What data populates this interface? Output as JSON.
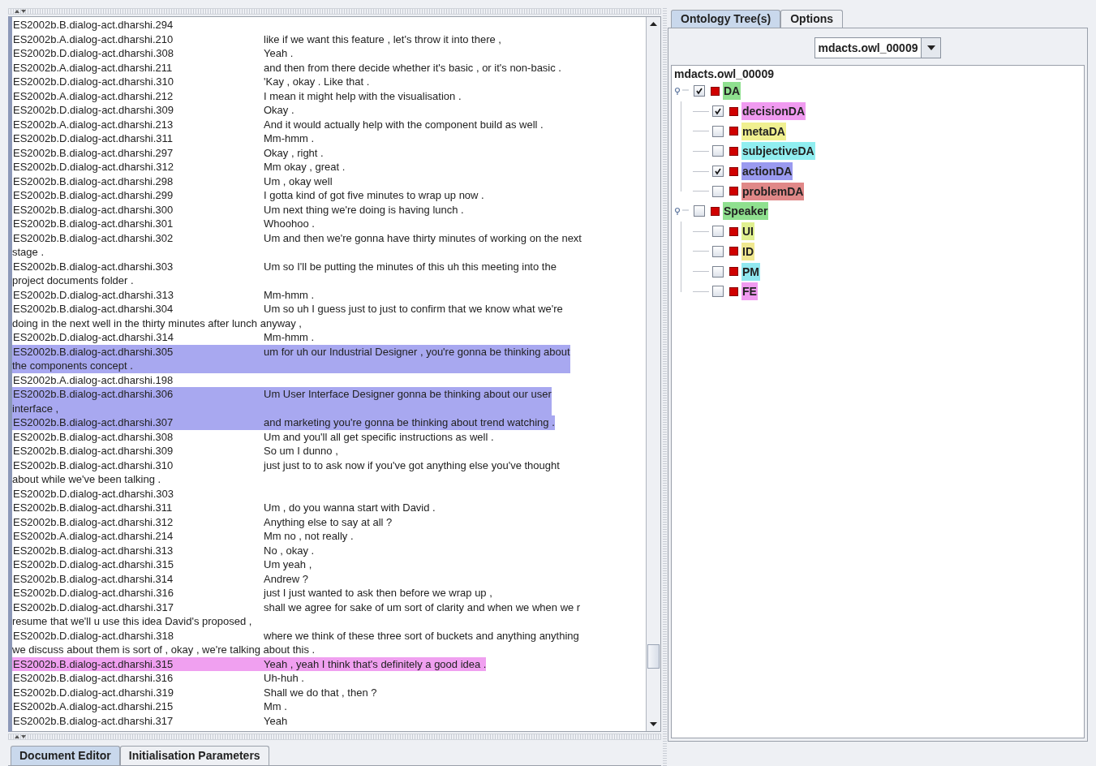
{
  "transcript": {
    "rows": [
      {
        "id": "ES2002b.B.dialog-act.dharshi.294",
        "text": ""
      },
      {
        "id": "ES2002b.A.dialog-act.dharshi.210",
        "text": "like if we want this feature , let's throw it into there ,"
      },
      {
        "id": "ES2002b.D.dialog-act.dharshi.308",
        "text": "Yeah ."
      },
      {
        "id": "ES2002b.A.dialog-act.dharshi.211",
        "text": "and then from there decide whether it's basic , or it's non-basic ."
      },
      {
        "id": "ES2002b.D.dialog-act.dharshi.310",
        "text": "'Kay , okay . Like that ."
      },
      {
        "id": "ES2002b.A.dialog-act.dharshi.212",
        "text": "I mean it might help with the visualisation ."
      },
      {
        "id": "ES2002b.D.dialog-act.dharshi.309",
        "text": "Okay ."
      },
      {
        "id": "ES2002b.A.dialog-act.dharshi.213",
        "text": "And it would actually help with the component build as well ."
      },
      {
        "id": "ES2002b.D.dialog-act.dharshi.311",
        "text": "Mm-hmm ."
      },
      {
        "id": "ES2002b.B.dialog-act.dharshi.297",
        "text": "Okay , right ."
      },
      {
        "id": "ES2002b.D.dialog-act.dharshi.312",
        "text": "Mm okay , great ."
      },
      {
        "id": "ES2002b.B.dialog-act.dharshi.298",
        "text": "Um , okay well"
      },
      {
        "id": "ES2002b.B.dialog-act.dharshi.299",
        "text": "I gotta kind of got five minutes to wrap up now ."
      },
      {
        "id": "ES2002b.B.dialog-act.dharshi.300",
        "text": "Um next thing we're doing is having lunch ."
      },
      {
        "id": "ES2002b.B.dialog-act.dharshi.301",
        "text": "Whoohoo ."
      },
      {
        "id": "ES2002b.B.dialog-act.dharshi.302",
        "text": "Um and then we're gonna have thirty minutes of working on the next",
        "continuation": "stage ."
      },
      {
        "id": "ES2002b.B.dialog-act.dharshi.303",
        "text": "Um so I'll be putting the minutes of this uh this meeting into the",
        "continuation": "project documents folder ."
      },
      {
        "id": "ES2002b.D.dialog-act.dharshi.313",
        "text": "Mm-hmm ."
      },
      {
        "id": "ES2002b.B.dialog-act.dharshi.304",
        "text": "Um so uh I guess just to just to confirm that we know what we're",
        "continuation": "doing in the next well in the thirty minutes after lunch anyway ,"
      },
      {
        "id": "ES2002b.D.dialog-act.dharshi.314",
        "text": "Mm-hmm ."
      },
      {
        "id": "ES2002b.B.dialog-act.dharshi.305",
        "text": "um for uh our Industrial Designer , you're gonna be thinking about",
        "continuation": "the components concept .",
        "color": "#a8a8f0"
      },
      {
        "id": "ES2002b.A.dialog-act.dharshi.198",
        "text": ""
      },
      {
        "id": "ES2002b.B.dialog-act.dharshi.306",
        "text": "Um User Interface Designer gonna be thinking about our user",
        "continuation": "interface ,",
        "color": "#a8a8f0"
      },
      {
        "id": "ES2002b.B.dialog-act.dharshi.307",
        "text": "and marketing you're gonna be thinking about trend watching .",
        "color": "#a8a8f0"
      },
      {
        "id": "ES2002b.B.dialog-act.dharshi.308",
        "text": "Um and you'll all get specific instructions as well ."
      },
      {
        "id": "ES2002b.B.dialog-act.dharshi.309",
        "text": "So um I dunno ,"
      },
      {
        "id": "ES2002b.B.dialog-act.dharshi.310",
        "text": "just just to to ask now if you've got anything else you've thought",
        "continuation": "about while we've been talking ."
      },
      {
        "id": "ES2002b.D.dialog-act.dharshi.303",
        "text": ""
      },
      {
        "id": "ES2002b.B.dialog-act.dharshi.311",
        "text": "Um , do you wanna start with David ."
      },
      {
        "id": "ES2002b.B.dialog-act.dharshi.312",
        "text": "Anything else to say at all ?"
      },
      {
        "id": "ES2002b.A.dialog-act.dharshi.214",
        "text": "Mm no , not really ."
      },
      {
        "id": "ES2002b.B.dialog-act.dharshi.313",
        "text": "No , okay ."
      },
      {
        "id": "ES2002b.D.dialog-act.dharshi.315",
        "text": "Um yeah ,"
      },
      {
        "id": "ES2002b.B.dialog-act.dharshi.314",
        "text": "Andrew ?"
      },
      {
        "id": "ES2002b.D.dialog-act.dharshi.316",
        "text": "just I just wanted to ask then before we wrap up ,"
      },
      {
        "id": "ES2002b.D.dialog-act.dharshi.317",
        "text": "shall we agree for sake of um sort of clarity and when we when we r",
        "continuation": "resume that we'll u use this idea David's proposed ,"
      },
      {
        "id": "ES2002b.D.dialog-act.dharshi.318",
        "text": "where we think of these three sort of buckets and anything anything",
        "continuation": "we discuss about them is sort of , okay , we're talking about this ."
      },
      {
        "id": "ES2002b.B.dialog-act.dharshi.315",
        "text": "Yeah , yeah I think that's definitely a good idea .",
        "color": "#f0a0f0"
      },
      {
        "id": "ES2002b.B.dialog-act.dharshi.316",
        "text": "Uh-huh ."
      },
      {
        "id": "ES2002b.D.dialog-act.dharshi.319",
        "text": "Shall we do that , then ?"
      },
      {
        "id": "ES2002b.A.dialog-act.dharshi.215",
        "text": "Mm ."
      },
      {
        "id": "ES2002b.B.dialog-act.dharshi.317",
        "text": "Yeah"
      }
    ]
  },
  "bottom_tabs": [
    {
      "label": "Document Editor",
      "selected": true
    },
    {
      "label": "Initialisation Parameters",
      "selected": false
    }
  ],
  "right_tabs": [
    {
      "label": "Ontology Tree(s)",
      "selected": true
    },
    {
      "label": "Options",
      "selected": false
    }
  ],
  "ontology_select": {
    "value": "mdacts.owl_00009"
  },
  "tree": {
    "root": "mdacts.owl_00009",
    "nodes": [
      {
        "label": "DA",
        "checked": true,
        "expanded": true,
        "color": "#8fe08f",
        "children": [
          {
            "label": "decisionDA",
            "checked": true,
            "color": "#f09af0"
          },
          {
            "label": "metaDA",
            "checked": false,
            "color": "#f0f090"
          },
          {
            "label": "subjectiveDA",
            "checked": false,
            "color": "#90eef0"
          },
          {
            "label": "actionDA",
            "checked": true,
            "color": "#9a9af0"
          },
          {
            "label": "problemDA",
            "checked": false,
            "color": "#e08888"
          }
        ]
      },
      {
        "label": "Speaker",
        "checked": false,
        "expanded": true,
        "color": "#8fe08f",
        "children": [
          {
            "label": "UI",
            "checked": false,
            "color": "#e0f090"
          },
          {
            "label": "ID",
            "checked": false,
            "color": "#f0e890"
          },
          {
            "label": "PM",
            "checked": false,
            "color": "#90e8f0"
          },
          {
            "label": "FE",
            "checked": false,
            "color": "#f09af0"
          }
        ]
      }
    ]
  }
}
